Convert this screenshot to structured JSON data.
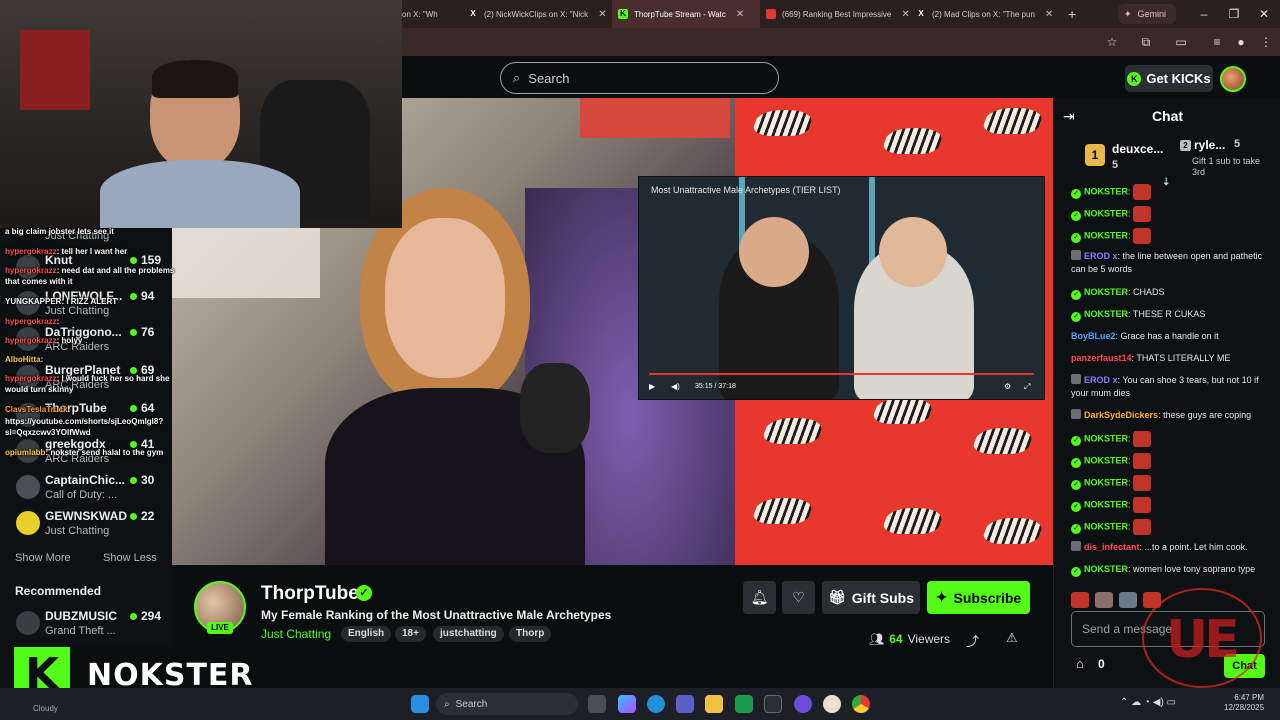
{
  "browser": {
    "tabs": [
      {
        "label": "on X: \"Wh"
      },
      {
        "label": "(2) NickWickClips on X: \"Nick"
      },
      {
        "label": "ThorpTube Stream - Watc",
        "active": true
      },
      {
        "label": "(669) Ranking Best Impressive"
      },
      {
        "label": "(2) Mad Clips on X: \"The pun"
      }
    ],
    "gemini_label": "Gemini"
  },
  "header": {
    "search_placeholder": "Search",
    "get_kicks": "Get KICKs"
  },
  "sidebar": {
    "channels": [
      {
        "name": "Knut",
        "viewers": "159",
        "category": ""
      },
      {
        "name": "LONEWOLF...",
        "viewers": "94",
        "category": "Just Chatting"
      },
      {
        "name": "DaTriggono...",
        "viewers": "76",
        "category": "ARC Raiders"
      },
      {
        "name": "BurgerPlanet",
        "viewers": "69",
        "category": "ARC Raiders"
      },
      {
        "name": "ThorpTube",
        "viewers": "64",
        "category": ""
      },
      {
        "name": "greekgodx",
        "viewers": "41",
        "category": "ARC Raiders"
      },
      {
        "name": "CaptainChic...",
        "viewers": "30",
        "category": "Call of Duty: ..."
      },
      {
        "name": "GEWNSKWAD",
        "viewers": "22",
        "category": "Just Chatting"
      }
    ],
    "top_category": "Just Chatting",
    "show_more": "Show More",
    "show_less": "Show Less",
    "recommended_title": "Recommended",
    "recommended": [
      {
        "name": "DUBZMUSIC",
        "viewers": "294",
        "category": "Grand Theft ..."
      }
    ]
  },
  "overlay_chat": [
    {
      "user": "",
      "text": "a big claim jobster lets see it",
      "color": "#ffffff"
    },
    {
      "user": "hypergokrazz",
      "text": ": tell her I want her",
      "color": "#ff4d4d"
    },
    {
      "user": "hypergokrazz",
      "text": ": need dat and all the problems that comes with it",
      "color": "#ff4d4d"
    },
    {
      "user": "YUNGKAPPER",
      "text": ": I RIZZ ALERT",
      "color": "#ffffff"
    },
    {
      "user": "hypergokrazz",
      "text": ":",
      "color": "#ff4d4d"
    },
    {
      "user": "hypergokrazz",
      "text": ": holyy",
      "color": "#ff4d4d"
    },
    {
      "user": "AlboHitta",
      "text": ":",
      "color": "#ffcc33"
    },
    {
      "user": "hypergokrazz",
      "text": ": I would fuck her so hard she would turn skinny",
      "color": "#ff4d4d"
    },
    {
      "user": "ClavsTeslaTruck",
      "text": ":",
      "color": "#ff9933"
    },
    {
      "user": "",
      "text": "https://youtube.com/shorts/sjLeoQmlgI8?si=Qqxzcwv3YOIfWwd",
      "color": "#ffffff"
    },
    {
      "user": "opiumlabb",
      "text": ": nokster send halal to the gym",
      "color": "#ffcc33"
    }
  ],
  "player": {
    "inner_video_title": "Most Unattractive Male Archetypes (TIER LIST)",
    "inner_video_time": "35:15 / 37:18"
  },
  "stream": {
    "channel": "ThorpTube",
    "live": "LIVE",
    "title": "My Female Ranking of the Most Unattractive Male Archetypes",
    "category": "Just Chatting",
    "tags": [
      "English",
      "18+",
      "justchatting",
      "Thorp"
    ],
    "gift_subs": "Gift Subs",
    "subscribe": "Subscribe",
    "viewers": "64",
    "viewers_label": "Viewers"
  },
  "chat": {
    "title": "Chat",
    "top_gifters": [
      {
        "rank": "1",
        "name": "deuxce...",
        "count": "5"
      },
      {
        "rank": "2",
        "name": "ryle...",
        "count": "5"
      }
    ],
    "gift_prompt": "Gift 1 sub to take 3rd",
    "messages": [
      {
        "user": "NOKSTER",
        "text": "",
        "color": "#53fc18",
        "emote": true
      },
      {
        "user": "NOKSTER",
        "text": "",
        "color": "#53fc18",
        "emote": true
      },
      {
        "user": "NOKSTER",
        "text": "",
        "color": "#53fc18",
        "emote": true
      },
      {
        "user": "EROD x",
        "text": ": the line between open and pathetic can be 5 words",
        "color": "#8d7cff"
      },
      {
        "user": "NOKSTER",
        "text": ": CHADS",
        "color": "#53fc18"
      },
      {
        "user": "NOKSTER",
        "text": ": THESE R CUKAS",
        "color": "#53fc18"
      },
      {
        "user": "BoyBLue2",
        "text": ": Grace has a handle on it",
        "color": "#4aa3ff"
      },
      {
        "user": "panzerfaust14",
        "text": ": THATS LITERALLY ME",
        "color": "#ff4d4d"
      },
      {
        "user": "EROD x",
        "text": ": You can shoe 3 tears, but not 10 if your mum dies",
        "color": "#8d7cff"
      },
      {
        "user": "DarkSydeDickers",
        "text": ": these guys are coping",
        "color": "#ffb020"
      },
      {
        "user": "NOKSTER",
        "text": "",
        "color": "#53fc18",
        "emote": true
      },
      {
        "user": "NOKSTER",
        "text": "",
        "color": "#53fc18",
        "emote": true
      },
      {
        "user": "NOKSTER",
        "text": "",
        "color": "#53fc18",
        "emote": true
      },
      {
        "user": "NOKSTER",
        "text": "",
        "color": "#53fc18",
        "emote": true
      },
      {
        "user": "NOKSTER",
        "text": "",
        "color": "#53fc18",
        "emote": true
      },
      {
        "user": "dis_infectant",
        "text": ": ...to a point. Let him cook.",
        "color": "#ff4d4d"
      },
      {
        "user": "NOKSTER",
        "text": ": women love tony soprano type",
        "color": "#53fc18"
      }
    ],
    "input_placeholder": "Send a message",
    "points": "0",
    "send_label": "Chat"
  },
  "overlay_logo": {
    "text": "NOKSTER",
    "k": "K"
  },
  "watermark": {
    "letters": "UE"
  },
  "taskbar": {
    "weather": "Cloudy",
    "search": "Search",
    "time": "6:47 PM",
    "date": "12/28/2025"
  },
  "colors": {
    "accent": "#53fc18",
    "background": "#0b0e0f",
    "panel": "#0e1113",
    "zebra_red": "#e8382e"
  }
}
